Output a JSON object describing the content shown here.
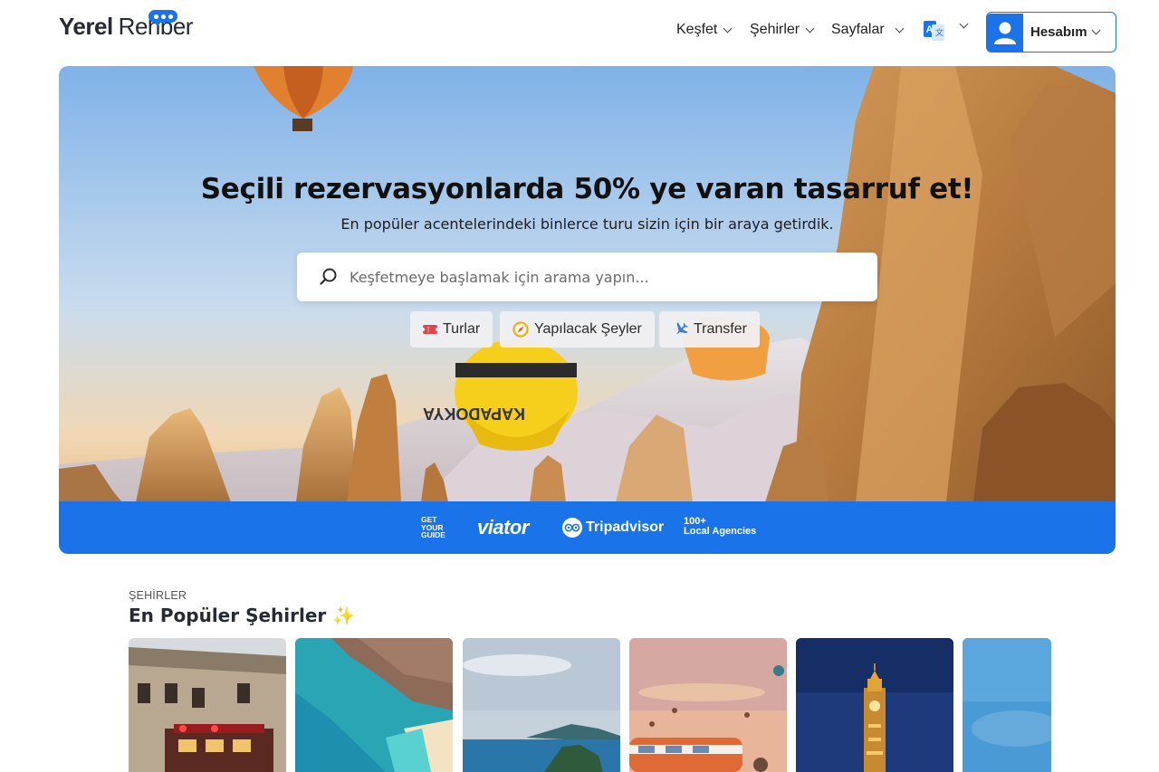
{
  "header": {
    "logo": {
      "part1": "Yerel",
      "part2": "Rehber"
    },
    "nav": [
      {
        "label": "Keşfet"
      },
      {
        "label": "Şehirler"
      },
      {
        "label": "Sayfalar"
      }
    ],
    "language_icon": "translate-icon",
    "account_label": "Hesabım",
    "account_icon": "user-icon"
  },
  "hero": {
    "title": "Seçili rezervasyonlarda 50% ye varan tasarruf et!",
    "subtitle": "En popüler acentelerindeki binlerce turu sizin için bir araya getirdik.",
    "search_placeholder": "Keşfetmeye başlamak için arama yapın...",
    "chips": [
      {
        "label": "Turlar",
        "icon": "ticket-icon"
      },
      {
        "label": "Yapılacak Şeyler",
        "icon": "compass-icon"
      },
      {
        "label": "Transfer",
        "icon": "airplane-icon"
      }
    ],
    "partners": {
      "gyg": [
        "GET",
        "YOUR",
        "GUIDE"
      ],
      "viator": "viator",
      "tripadvisor": "Tripadvisor",
      "local": [
        "100+",
        "Local Agencies"
      ]
    }
  },
  "cities": {
    "eyebrow": "ŞEHİRLER",
    "title": "En Popüler Şehirler ✨"
  },
  "colors": {
    "accent": "#1a73e8",
    "text": "#262a33"
  }
}
